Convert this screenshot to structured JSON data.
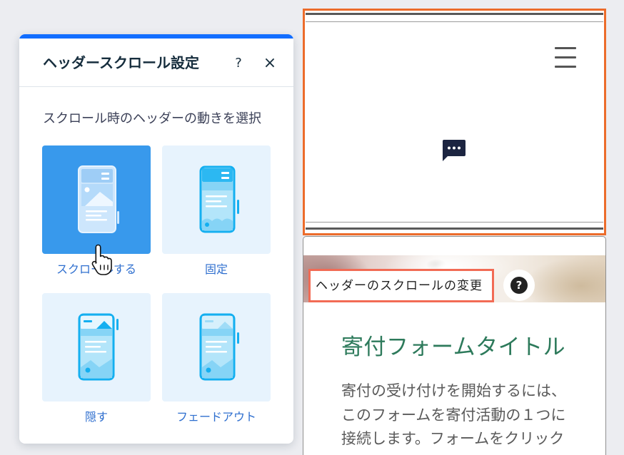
{
  "panel": {
    "title": "ヘッダースクロール設定",
    "help_glyph": "?",
    "close_glyph": "×",
    "subtitle": "スクロール時のヘッダーの動きを選択",
    "options": [
      {
        "label": "スクロールする",
        "selected": true,
        "icon": "phone-scroll-icon"
      },
      {
        "label": "固定",
        "selected": false,
        "icon": "phone-fixed-icon"
      },
      {
        "label": "隠す",
        "selected": false,
        "icon": "phone-hide-icon"
      },
      {
        "label": "フェードアウト",
        "selected": false,
        "icon": "phone-fade-icon"
      }
    ]
  },
  "cursor": {
    "icon": "hand-pointer-cursor-icon"
  },
  "preview": {
    "header": {
      "menu_icon": "hamburger-menu-icon",
      "chat_icon": "chat-bubble-icon"
    },
    "tooltip": {
      "label": "ヘッダーのスクロールの変更",
      "help_glyph": "?"
    },
    "form": {
      "title": "寄付フォームタイトル",
      "body_lines": [
        "寄付の受け付けを開始するには、",
        "このフォームを寄付活動の１つに",
        "接続します。フォームをクリック"
      ]
    }
  },
  "colors": {
    "panel_accent": "#116dff",
    "selected_tile": "#3899ec",
    "tile": "#e7f3fd",
    "option_label": "#2f6fcf",
    "header_highlight": "#ec6c2b",
    "tooltip_border": "#f26b55",
    "form_title": "#2d7a5b"
  }
}
